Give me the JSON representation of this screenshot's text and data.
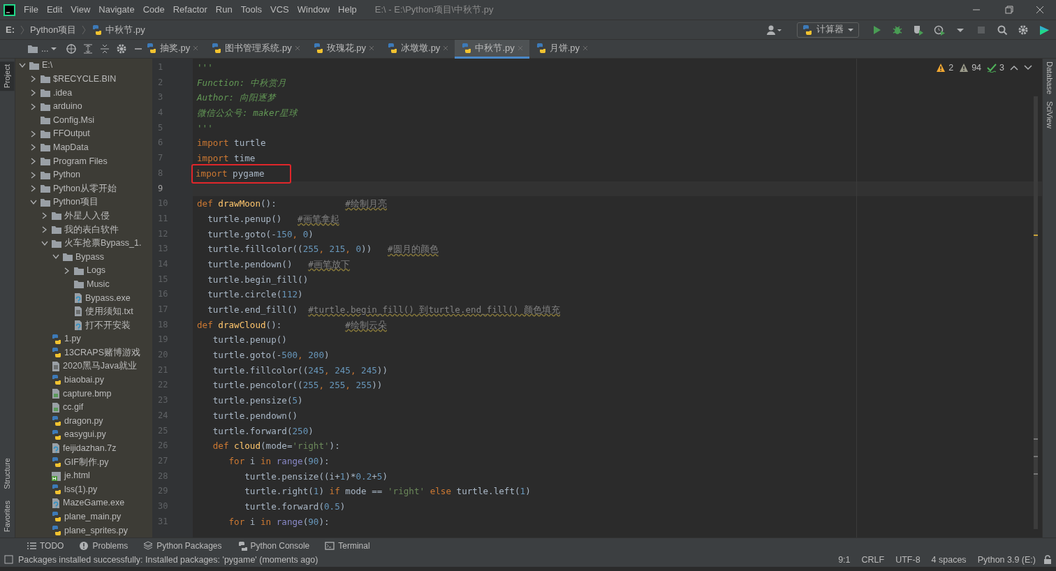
{
  "window": {
    "title": "E:\\ - E:\\Python项目\\中秋节.py"
  },
  "menu": [
    "File",
    "Edit",
    "View",
    "Navigate",
    "Code",
    "Refactor",
    "Run",
    "Tools",
    "VCS",
    "Window",
    "Help"
  ],
  "breadcrumb": [
    {
      "label": "E:",
      "kind": "drive"
    },
    {
      "label": "Python项目",
      "kind": "folder"
    },
    {
      "label": "中秋节.py",
      "kind": "file"
    }
  ],
  "run_config": {
    "label": "计算器"
  },
  "project_view_label": "...",
  "side_tools_left": [
    {
      "label": "Project",
      "selected": true
    },
    {
      "label": "Structure",
      "selected": false
    },
    {
      "label": "Favorites",
      "selected": false
    }
  ],
  "side_tools_right": [
    {
      "label": "Database"
    },
    {
      "label": "SciView"
    }
  ],
  "tabs": [
    {
      "label": "抽奖.py",
      "selected": false
    },
    {
      "label": "图书管理系统.py",
      "selected": false
    },
    {
      "label": "玫瑰花.py",
      "selected": false
    },
    {
      "label": "冰墩墩.py",
      "selected": false
    },
    {
      "label": "中秋节.py",
      "selected": true
    },
    {
      "label": "月饼.py",
      "selected": false
    }
  ],
  "tree": [
    {
      "label": "E:\\",
      "kind": "folder",
      "expanded": true,
      "children": [
        {
          "label": "$RECYCLE.BIN",
          "kind": "folder",
          "expanded": false
        },
        {
          "label": ".idea",
          "kind": "folder",
          "expanded": false
        },
        {
          "label": "arduino",
          "kind": "folder",
          "expanded": false
        },
        {
          "label": "Config.Msi",
          "kind": "folder"
        },
        {
          "label": "FFOutput",
          "kind": "folder",
          "expanded": false
        },
        {
          "label": "MapData",
          "kind": "folder",
          "expanded": false
        },
        {
          "label": "Program Files",
          "kind": "folder",
          "expanded": false
        },
        {
          "label": "Python",
          "kind": "folder",
          "expanded": false
        },
        {
          "label": "Python从零开始",
          "kind": "folder",
          "expanded": false
        },
        {
          "label": "Python项目",
          "kind": "folder",
          "expanded": true,
          "children": [
            {
              "label": "外星人入侵",
              "kind": "folder",
              "expanded": false
            },
            {
              "label": "我的表白软件",
              "kind": "folder",
              "expanded": false
            },
            {
              "label": "火车抢票Bypass_1.",
              "kind": "folder",
              "expanded": true,
              "children": [
                {
                  "label": "Bypass",
                  "kind": "folder",
                  "expanded": true,
                  "children": [
                    {
                      "label": "Logs",
                      "kind": "folder",
                      "expanded": false
                    },
                    {
                      "label": "Music",
                      "kind": "folder"
                    },
                    {
                      "label": "Bypass.exe",
                      "kind": "unknown"
                    },
                    {
                      "label": "使用须知.txt",
                      "kind": "text"
                    },
                    {
                      "label": "打不开安装",
                      "kind": "unknown"
                    }
                  ]
                }
              ]
            },
            {
              "label": "1.py",
              "kind": "python"
            },
            {
              "label": "13CRAPS赌博游戏",
              "kind": "python"
            },
            {
              "label": "2020黑马Java就业",
              "kind": "text"
            },
            {
              "label": "biaobai.py",
              "kind": "python"
            },
            {
              "label": "capture.bmp",
              "kind": "image"
            },
            {
              "label": "cc.gif",
              "kind": "image"
            },
            {
              "label": "dragon.py",
              "kind": "python"
            },
            {
              "label": "easygui.py",
              "kind": "python"
            },
            {
              "label": "feijidazhan.7z",
              "kind": "unknown"
            },
            {
              "label": "GIF制作.py",
              "kind": "python"
            },
            {
              "label": "je.html",
              "kind": "html"
            },
            {
              "label": "lss(1).py",
              "kind": "python"
            },
            {
              "label": "MazeGame.exe",
              "kind": "unknown"
            },
            {
              "label": "plane_main.py",
              "kind": "python"
            },
            {
              "label": "plane_sprites.py",
              "kind": "python"
            }
          ]
        }
      ]
    }
  ],
  "inspections": [
    {
      "count": "2",
      "kind": "warning"
    },
    {
      "count": "94",
      "kind": "weak-warning"
    },
    {
      "count": "3",
      "kind": "typo"
    }
  ],
  "code": [
    {
      "number": "1",
      "current": false,
      "boxed": false,
      "tokens": [
        {
          "text": "'''",
          "kind": "doc"
        }
      ]
    },
    {
      "number": "2",
      "current": false,
      "boxed": false,
      "tokens": [
        {
          "text": "Function: 中秋赏月",
          "kind": "doc"
        }
      ]
    },
    {
      "number": "3",
      "current": false,
      "boxed": false,
      "tokens": [
        {
          "text": "Author: 向阳逐梦",
          "kind": "doc"
        }
      ]
    },
    {
      "number": "4",
      "current": false,
      "boxed": false,
      "tokens": [
        {
          "text": "微信公众号: maker星球",
          "kind": "doc"
        }
      ]
    },
    {
      "number": "5",
      "current": false,
      "boxed": false,
      "tokens": [
        {
          "text": "'''",
          "kind": "doc"
        }
      ]
    },
    {
      "number": "6",
      "current": false,
      "boxed": false,
      "tokens": [
        {
          "text": "import",
          "kind": "kw"
        },
        {
          "text": " turtle",
          "kind": "plain"
        }
      ]
    },
    {
      "number": "7",
      "current": false,
      "boxed": false,
      "tokens": [
        {
          "text": "import",
          "kind": "kw"
        },
        {
          "text": " time",
          "kind": "plain"
        }
      ]
    },
    {
      "number": "8",
      "current": false,
      "boxed": true,
      "tokens": [
        {
          "text": "import",
          "kind": "kw"
        },
        {
          "text": " pygame",
          "kind": "plain"
        }
      ]
    },
    {
      "number": "9",
      "current": true,
      "boxed": false
    },
    {
      "number": "10",
      "current": false,
      "boxed": false,
      "tokens": [
        {
          "text": "def",
          "kind": "kw"
        },
        {
          "text": " drawMoon",
          "kind": "fn"
        },
        {
          "text": "():             ",
          "kind": "plain"
        },
        {
          "text": "#绘制月亮",
          "kind": "cmt"
        }
      ]
    },
    {
      "number": "11",
      "current": false,
      "boxed": false,
      "tokens": [
        {
          "text": "  turtle.penup()   ",
          "kind": "plain"
        },
        {
          "text": "#画笔拿起",
          "kind": "cmt"
        }
      ]
    },
    {
      "number": "12",
      "current": false,
      "boxed": false,
      "tokens": [
        {
          "text": "  turtle.goto(-",
          "kind": "plain"
        },
        {
          "text": "150",
          "kind": "num"
        },
        {
          "text": ", ",
          "kind": "kw"
        },
        {
          "text": "0",
          "kind": "num"
        },
        {
          "text": ")",
          "kind": "plain"
        }
      ]
    },
    {
      "number": "13",
      "current": false,
      "boxed": false,
      "tokens": [
        {
          "text": "  turtle.fillcolor((",
          "kind": "plain"
        },
        {
          "text": "255",
          "kind": "num"
        },
        {
          "text": ", ",
          "kind": "kw"
        },
        {
          "text": "215",
          "kind": "num"
        },
        {
          "text": ", ",
          "kind": "kw"
        },
        {
          "text": "0",
          "kind": "num"
        },
        {
          "text": "))   ",
          "kind": "plain"
        },
        {
          "text": "#圆月的颜色",
          "kind": "cmt"
        }
      ]
    },
    {
      "number": "14",
      "current": false,
      "boxed": false,
      "tokens": [
        {
          "text": "  turtle.pendown()   ",
          "kind": "plain"
        },
        {
          "text": "#画笔放下",
          "kind": "cmt"
        }
      ]
    },
    {
      "number": "15",
      "current": false,
      "boxed": false,
      "tokens": [
        {
          "text": "  turtle.begin_fill()",
          "kind": "plain"
        }
      ]
    },
    {
      "number": "16",
      "current": false,
      "boxed": false,
      "tokens": [
        {
          "text": "  turtle.circle(",
          "kind": "plain"
        },
        {
          "text": "112",
          "kind": "num"
        },
        {
          "text": ")",
          "kind": "plain"
        }
      ]
    },
    {
      "number": "17",
      "current": false,
      "boxed": false,
      "tokens": [
        {
          "text": "  turtle.end_fill()  ",
          "kind": "plain"
        },
        {
          "text": "#turtle.begin_fill() 到turtle.end_fill() 颜色填充",
          "kind": "cmt"
        }
      ]
    },
    {
      "number": "18",
      "current": false,
      "boxed": false,
      "tokens": [
        {
          "text": "def",
          "kind": "kw"
        },
        {
          "text": " drawCloud",
          "kind": "fn"
        },
        {
          "text": "():            ",
          "kind": "plain"
        },
        {
          "text": "#绘制云朵",
          "kind": "cmt"
        }
      ]
    },
    {
      "number": "19",
      "current": false,
      "boxed": false,
      "tokens": [
        {
          "text": "   turtle.penup()",
          "kind": "plain"
        }
      ]
    },
    {
      "number": "20",
      "current": false,
      "boxed": false,
      "tokens": [
        {
          "text": "   turtle.goto(-",
          "kind": "plain"
        },
        {
          "text": "500",
          "kind": "num"
        },
        {
          "text": ", ",
          "kind": "kw"
        },
        {
          "text": "200",
          "kind": "num"
        },
        {
          "text": ")",
          "kind": "plain"
        }
      ]
    },
    {
      "number": "21",
      "current": false,
      "boxed": false,
      "tokens": [
        {
          "text": "   turtle.fillcolor((",
          "kind": "plain"
        },
        {
          "text": "245",
          "kind": "num"
        },
        {
          "text": ", ",
          "kind": "kw"
        },
        {
          "text": "245",
          "kind": "num"
        },
        {
          "text": ", ",
          "kind": "kw"
        },
        {
          "text": "245",
          "kind": "num"
        },
        {
          "text": "))",
          "kind": "plain"
        }
      ]
    },
    {
      "number": "22",
      "current": false,
      "boxed": false,
      "tokens": [
        {
          "text": "   turtle.pencolor((",
          "kind": "plain"
        },
        {
          "text": "255",
          "kind": "num"
        },
        {
          "text": ", ",
          "kind": "kw"
        },
        {
          "text": "255",
          "kind": "num"
        },
        {
          "text": ", ",
          "kind": "kw"
        },
        {
          "text": "255",
          "kind": "num"
        },
        {
          "text": "))",
          "kind": "plain"
        }
      ]
    },
    {
      "number": "23",
      "current": false,
      "boxed": false,
      "tokens": [
        {
          "text": "   turtle.pensize(",
          "kind": "plain"
        },
        {
          "text": "5",
          "kind": "num"
        },
        {
          "text": ")",
          "kind": "plain"
        }
      ]
    },
    {
      "number": "24",
      "current": false,
      "boxed": false,
      "tokens": [
        {
          "text": "   turtle.pendown()",
          "kind": "plain"
        }
      ]
    },
    {
      "number": "25",
      "current": false,
      "boxed": false,
      "tokens": [
        {
          "text": "   turtle.forward(",
          "kind": "plain"
        },
        {
          "text": "250",
          "kind": "num"
        },
        {
          "text": ")",
          "kind": "plain"
        }
      ]
    },
    {
      "number": "26",
      "current": false,
      "boxed": false,
      "tokens": [
        {
          "text": "   def",
          "kind": "kw"
        },
        {
          "text": " cloud",
          "kind": "fn"
        },
        {
          "text": "(mode=",
          "kind": "plain"
        },
        {
          "text": "'right'",
          "kind": "str"
        },
        {
          "text": "):",
          "kind": "plain"
        }
      ]
    },
    {
      "number": "27",
      "current": false,
      "boxed": false,
      "tokens": [
        {
          "text": "      for",
          "kind": "kw"
        },
        {
          "text": " i ",
          "kind": "plain"
        },
        {
          "text": "in",
          "kind": "kw"
        },
        {
          "text": " range",
          "kind": "builtin"
        },
        {
          "text": "(",
          "kind": "plain"
        },
        {
          "text": "90",
          "kind": "num"
        },
        {
          "text": "):",
          "kind": "plain"
        }
      ]
    },
    {
      "number": "28",
      "current": false,
      "boxed": false,
      "tokens": [
        {
          "text": "         turtle.pensize((i+",
          "kind": "plain"
        },
        {
          "text": "1",
          "kind": "num"
        },
        {
          "text": ")*",
          "kind": "plain"
        },
        {
          "text": "0.2",
          "kind": "num"
        },
        {
          "text": "+",
          "kind": "plain"
        },
        {
          "text": "5",
          "kind": "num"
        },
        {
          "text": ")",
          "kind": "plain"
        }
      ]
    },
    {
      "number": "29",
      "current": false,
      "boxed": false,
      "tokens": [
        {
          "text": "         turtle.right(",
          "kind": "plain"
        },
        {
          "text": "1",
          "kind": "num"
        },
        {
          "text": ") ",
          "kind": "plain"
        },
        {
          "text": "if",
          "kind": "kw"
        },
        {
          "text": " mode == ",
          "kind": "plain"
        },
        {
          "text": "'right'",
          "kind": "str"
        },
        {
          "text": " else",
          "kind": "kw"
        },
        {
          "text": " turtle.left(",
          "kind": "plain"
        },
        {
          "text": "1",
          "kind": "num"
        },
        {
          "text": ")",
          "kind": "plain"
        }
      ]
    },
    {
      "number": "30",
      "current": false,
      "boxed": false,
      "tokens": [
        {
          "text": "         turtle.forward(",
          "kind": "plain"
        },
        {
          "text": "0.5",
          "kind": "num"
        },
        {
          "text": ")",
          "kind": "plain"
        }
      ]
    },
    {
      "number": "31",
      "current": false,
      "boxed": false,
      "tokens": [
        {
          "text": "      for",
          "kind": "kw"
        },
        {
          "text": " i ",
          "kind": "plain"
        },
        {
          "text": "in",
          "kind": "kw"
        },
        {
          "text": " range",
          "kind": "builtin"
        },
        {
          "text": "(",
          "kind": "plain"
        },
        {
          "text": "90",
          "kind": "num"
        },
        {
          "text": "):",
          "kind": "plain"
        }
      ]
    }
  ],
  "tool_windows": [
    {
      "label": "TODO",
      "kind": "list"
    },
    {
      "label": "Problems",
      "kind": "problems"
    },
    {
      "label": "Python Packages",
      "kind": "packages"
    },
    {
      "label": "Python Console",
      "kind": "console"
    },
    {
      "label": "Terminal",
      "kind": "terminal"
    }
  ],
  "status_bar": {
    "message": "Packages installed successfully: Installed packages: 'pygame' (moments ago)",
    "items": [
      "9:1",
      "CRLF",
      "UTF-8",
      "4 spaces",
      "Python 3.9 (E:)"
    ]
  }
}
